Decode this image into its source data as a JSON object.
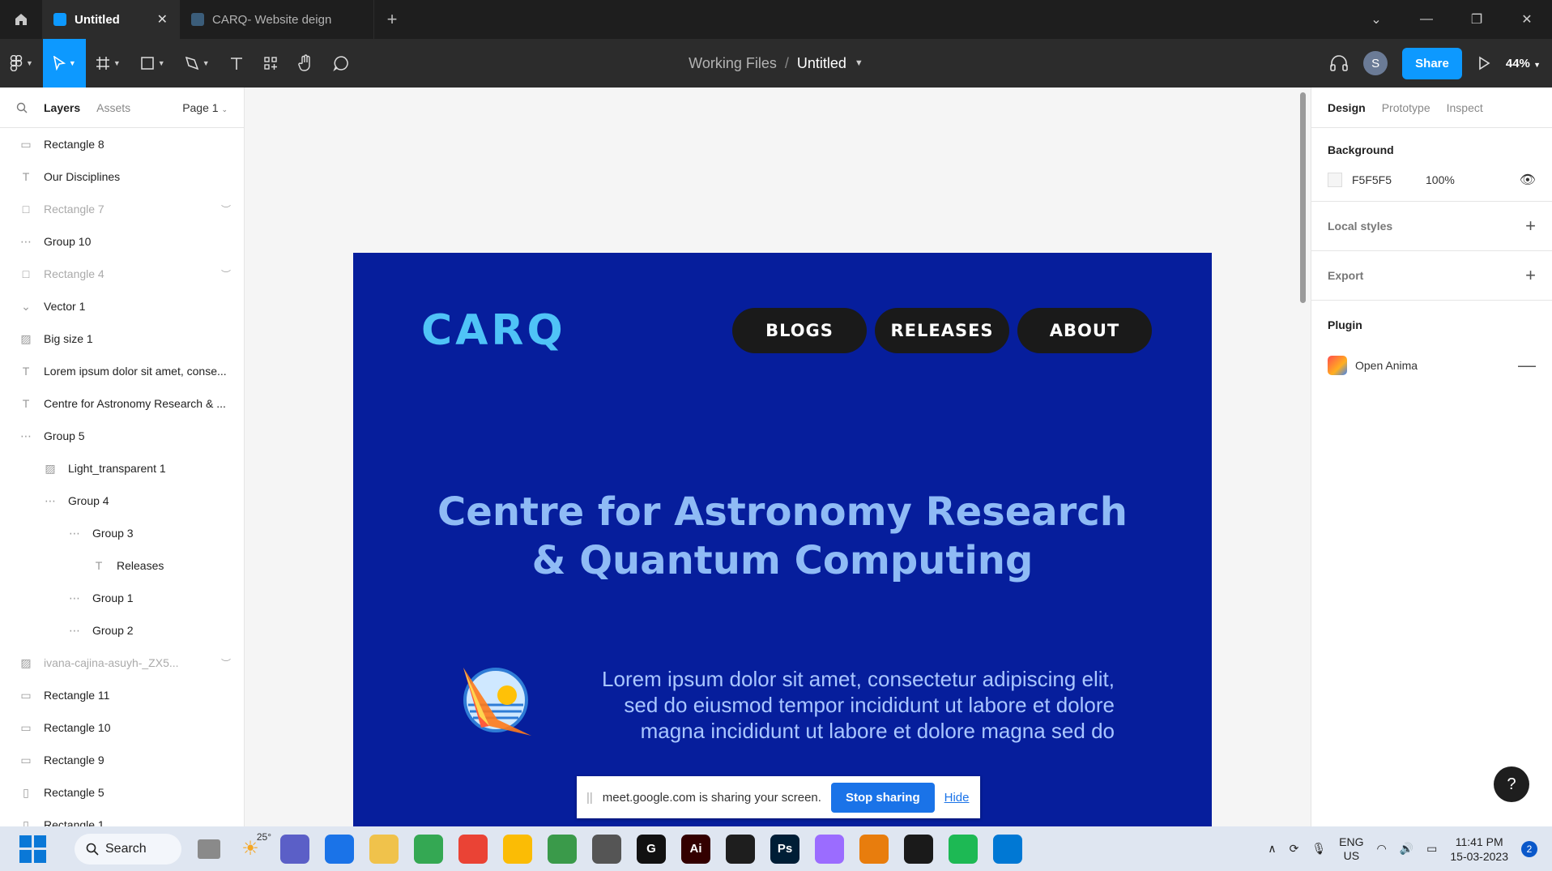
{
  "tabs": [
    {
      "label": "Untitled",
      "active": true
    },
    {
      "label": "CARQ- Website deign",
      "active": false
    }
  ],
  "breadcrumb": {
    "folder": "Working Files",
    "separator": "/",
    "file": "Untitled"
  },
  "toolbar": {
    "avatar_initial": "S",
    "share_label": "Share",
    "zoom": "44%"
  },
  "left_panel": {
    "tab_layers": "Layers",
    "tab_assets": "Assets",
    "page": "Page 1",
    "layers": [
      {
        "label": "Rectangle 8",
        "icon": "rect-line-icon",
        "indent": 0,
        "hidden": false
      },
      {
        "label": "Our Disciplines",
        "icon": "text-icon",
        "indent": 0,
        "hidden": false
      },
      {
        "label": "Rectangle 7",
        "icon": "rectangle-icon",
        "indent": 0,
        "hidden": true
      },
      {
        "label": "Group 10",
        "icon": "group-icon",
        "indent": 0,
        "hidden": false
      },
      {
        "label": "Rectangle 4",
        "icon": "rectangle-icon",
        "indent": 0,
        "hidden": true
      },
      {
        "label": "Vector 1",
        "icon": "vector-icon",
        "indent": 0,
        "hidden": false
      },
      {
        "label": "Big size 1",
        "icon": "image-icon",
        "indent": 0,
        "hidden": false
      },
      {
        "label": "Lorem ipsum dolor sit amet, conse...",
        "icon": "text-icon",
        "indent": 0,
        "hidden": false
      },
      {
        "label": "Centre for Astronomy Research & ...",
        "icon": "text-icon",
        "indent": 0,
        "hidden": false
      },
      {
        "label": "Group 5",
        "icon": "group-icon",
        "indent": 0,
        "hidden": false
      },
      {
        "label": "Light_transparent 1",
        "icon": "image-icon",
        "indent": 1,
        "hidden": false
      },
      {
        "label": "Group 4",
        "icon": "group-icon",
        "indent": 1,
        "hidden": false
      },
      {
        "label": "Group 3",
        "icon": "group-icon",
        "indent": 2,
        "hidden": false
      },
      {
        "label": "Releases",
        "icon": "text-icon",
        "indent": 3,
        "hidden": false
      },
      {
        "label": "Group 1",
        "icon": "group-icon",
        "indent": 2,
        "hidden": false
      },
      {
        "label": "Group 2",
        "icon": "group-icon",
        "indent": 2,
        "hidden": false
      },
      {
        "label": "ivana-cajina-asuyh-_ZX5...",
        "icon": "image-icon",
        "indent": 0,
        "hidden": true
      },
      {
        "label": "Rectangle 11",
        "icon": "rect-line-icon",
        "indent": 0,
        "hidden": false
      },
      {
        "label": "Rectangle 10",
        "icon": "rect-line-icon",
        "indent": 0,
        "hidden": false
      },
      {
        "label": "Rectangle 9",
        "icon": "rect-line-icon",
        "indent": 0,
        "hidden": false
      },
      {
        "label": "Rectangle 5",
        "icon": "rect-vertical-icon",
        "indent": 0,
        "hidden": false
      },
      {
        "label": "Rectangle 1",
        "icon": "rect-vertical-icon",
        "indent": 0,
        "hidden": false
      }
    ]
  },
  "canvas": {
    "logo_text": "CARQ",
    "nav": [
      "BLOGS",
      "RELEASES",
      "ABOUT"
    ],
    "hero_line1": "Centre for Astronomy Research",
    "hero_line2": "& Quantum Computing",
    "lorem_line1": "Lorem ipsum dolor sit amet, consectetur adipiscing elit,",
    "lorem_line2": "sed do eiusmod tempor incididunt ut labore et dolore",
    "lorem_line3": "magna  incididunt ut labore et dolore magna sed do",
    "frame_bg": "#061e9c"
  },
  "share_bar": {
    "message": "meet.google.com is sharing your screen.",
    "stop_label": "Stop sharing",
    "hide_label": "Hide"
  },
  "right_panel": {
    "tab_design": "Design",
    "tab_prototype": "Prototype",
    "tab_inspect": "Inspect",
    "background_title": "Background",
    "background_hex": "F5F5F5",
    "background_opacity": "100%",
    "local_styles": "Local styles",
    "export": "Export",
    "plugin_title": "Plugin",
    "plugin_name": "Open Anima",
    "help": "?"
  },
  "taskbar": {
    "search_label": "Search",
    "weather": "25°",
    "lang_line1": "ENG",
    "lang_line2": "US",
    "time": "11:41 PM",
    "date": "15-03-2023",
    "notifications": "2",
    "apps": [
      {
        "name": "file-explorer-icon",
        "color": "#f0c24b",
        "glyph": ""
      },
      {
        "name": "chrome-icon",
        "color": "#34a853",
        "glyph": ""
      },
      {
        "name": "chrome-icon",
        "color": "#ea4335",
        "glyph": ""
      },
      {
        "name": "chrome-icon",
        "color": "#fbbc05",
        "glyph": ""
      },
      {
        "name": "earth-icon",
        "color": "#3a9a4a",
        "glyph": ""
      },
      {
        "name": "unity-icon",
        "color": "#555555",
        "glyph": ""
      },
      {
        "name": "g-hub-icon",
        "color": "#111111",
        "glyph": "G"
      },
      {
        "name": "illustrator-icon",
        "color": "#330000",
        "glyph": "Ai"
      },
      {
        "name": "figma-icon",
        "color": "#1e1e1e",
        "glyph": ""
      },
      {
        "name": "photoshop-icon",
        "color": "#001e36",
        "glyph": "Ps"
      },
      {
        "name": "color-app-icon",
        "color": "#9b6cff",
        "glyph": ""
      },
      {
        "name": "blender-icon",
        "color": "#e87d0d",
        "glyph": ""
      },
      {
        "name": "cloud-icon",
        "color": "#1a1a1a",
        "glyph": ""
      },
      {
        "name": "spotify-icon",
        "color": "#1db954",
        "glyph": ""
      },
      {
        "name": "vscode-icon",
        "color": "#0078d4",
        "glyph": ""
      }
    ]
  }
}
